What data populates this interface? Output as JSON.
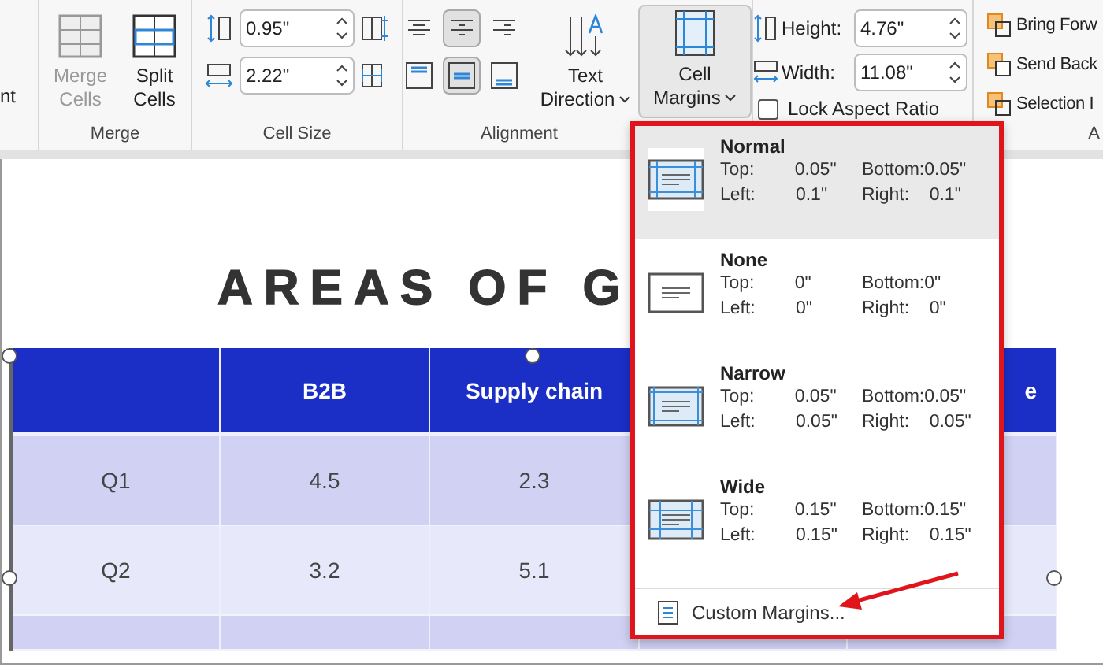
{
  "ribbon": {
    "partial_group": {
      "label": "nt"
    },
    "merge_group": {
      "label": "Merge",
      "buttons": [
        {
          "label": "Merge Cells",
          "disabled": true
        },
        {
          "label": "Split Cells",
          "disabled": false
        }
      ]
    },
    "cell_size_group": {
      "label": "Cell Size",
      "row_height": "0.95\"",
      "column_width": "2.22\""
    },
    "alignment_group": {
      "label": "Alignment",
      "horizontal": [
        {
          "selected": false
        },
        {
          "selected": true
        },
        {
          "selected": false
        }
      ],
      "vertical": [
        {
          "selected": false
        },
        {
          "selected": true
        },
        {
          "selected": false
        }
      ],
      "text_direction": "Text Direction"
    },
    "cell_margins_button": {
      "label": "Cell Margins",
      "expanded": true
    },
    "size_group": {
      "height_label": "Height:",
      "height": "4.76\"",
      "width_label": "Width:",
      "width": "11.08\"",
      "lock_aspect_ratio": {
        "label": "Lock Aspect Ratio",
        "checked": false
      }
    },
    "arrange_group": {
      "label": "A",
      "buttons": [
        "Bring Forw",
        "Send Back",
        "Selection I"
      ]
    }
  },
  "slide": {
    "title": "AREAS OF G",
    "table": {
      "header": {
        "column_2": "B2B",
        "column_3": "Supply chain",
        "column_5": "e"
      },
      "rows": [
        {
          "label": "Q1",
          "values": [
            "4.5",
            "2.3"
          ]
        },
        {
          "label": "Q2",
          "values": [
            "3.2",
            "5.1"
          ]
        }
      ]
    }
  },
  "cell_margins_menu": {
    "items": [
      {
        "kind": "normal",
        "name": "Normal",
        "selected": true,
        "fields": [
          {
            "label": "Top:",
            "value": "0.05\""
          },
          {
            "label": "Bottom:",
            "value": "0.05\""
          },
          {
            "label": "Left:",
            "value": "0.1\""
          },
          {
            "label": "Right:",
            "value": "0.1\""
          }
        ]
      },
      {
        "kind": "none",
        "name": "None",
        "selected": false,
        "fields": [
          {
            "label": "Top:",
            "value": "0\""
          },
          {
            "label": "Bottom:",
            "value": "0\""
          },
          {
            "label": "Left:",
            "value": "0\""
          },
          {
            "label": "Right:",
            "value": "0\""
          }
        ]
      },
      {
        "kind": "narrow",
        "name": "Narrow",
        "selected": false,
        "fields": [
          {
            "label": "Top:",
            "value": "0.05\""
          },
          {
            "label": "Bottom:",
            "value": "0.05\""
          },
          {
            "label": "Left:",
            "value": "0.05\""
          },
          {
            "label": "Right:",
            "value": "0.05\""
          }
        ]
      },
      {
        "kind": "wide",
        "name": "Wide",
        "selected": false,
        "fields": [
          {
            "label": "Top:",
            "value": "0.15\""
          },
          {
            "label": "Bottom:",
            "value": "0.15\""
          },
          {
            "label": "Left:",
            "value": "0.15\""
          },
          {
            "label": "Right:",
            "value": "0.15\""
          }
        ]
      }
    ],
    "custom": "Custom Margins..."
  }
}
